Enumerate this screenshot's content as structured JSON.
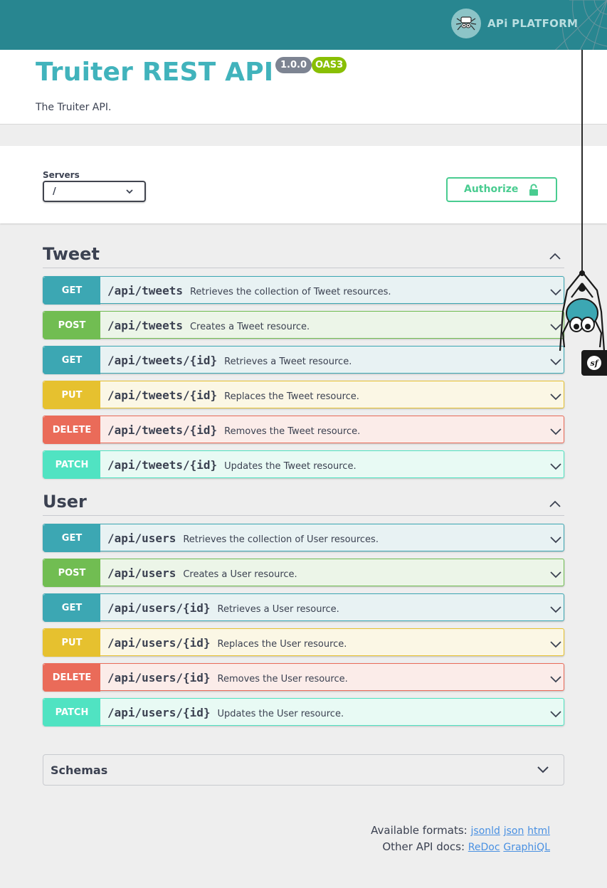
{
  "topbar": {
    "logo_text": "APi PLATFORM",
    "logo_icon": "spider-icon"
  },
  "info": {
    "title": "Truiter REST API",
    "version": "1.0.0",
    "oas": "OAS3",
    "description": "The Truiter API."
  },
  "scheme": {
    "servers_label": "Servers",
    "servers_value": "/",
    "authorize_label": "Authorize"
  },
  "tags": [
    {
      "name": "Tweet",
      "operations": [
        {
          "method": "GET",
          "path": "/api/tweets",
          "summary": "Retrieves the collection of Tweet resources."
        },
        {
          "method": "POST",
          "path": "/api/tweets",
          "summary": "Creates a Tweet resource."
        },
        {
          "method": "GET",
          "path": "/api/tweets/{id}",
          "summary": "Retrieves a Tweet resource."
        },
        {
          "method": "PUT",
          "path": "/api/tweets/{id}",
          "summary": "Replaces the Tweet resource."
        },
        {
          "method": "DELETE",
          "path": "/api/tweets/{id}",
          "summary": "Removes the Tweet resource."
        },
        {
          "method": "PATCH",
          "path": "/api/tweets/{id}",
          "summary": "Updates the Tweet resource."
        }
      ]
    },
    {
      "name": "User",
      "operations": [
        {
          "method": "GET",
          "path": "/api/users",
          "summary": "Retrieves the collection of User resources."
        },
        {
          "method": "POST",
          "path": "/api/users",
          "summary": "Creates a User resource."
        },
        {
          "method": "GET",
          "path": "/api/users/{id}",
          "summary": "Retrieves a User resource."
        },
        {
          "method": "PUT",
          "path": "/api/users/{id}",
          "summary": "Replaces the User resource."
        },
        {
          "method": "DELETE",
          "path": "/api/users/{id}",
          "summary": "Removes the User resource."
        },
        {
          "method": "PATCH",
          "path": "/api/users/{id}",
          "summary": "Updates the User resource."
        }
      ]
    }
  ],
  "schemas": {
    "label": "Schemas"
  },
  "footer": {
    "formats_label": "Available formats:",
    "formats": [
      "jsonld",
      "json",
      "html"
    ],
    "other_docs_label": "Other API docs:",
    "other_docs": [
      "ReDoc",
      "GraphiQL"
    ]
  },
  "colors": {
    "topbar": "#288690",
    "title": "#41b3bc",
    "get": "#3ca7b3",
    "post": "#71bd52",
    "put": "#e6c12f",
    "delete": "#ea6b59",
    "patch": "#50e3c2",
    "authorize": "#49cc90"
  }
}
